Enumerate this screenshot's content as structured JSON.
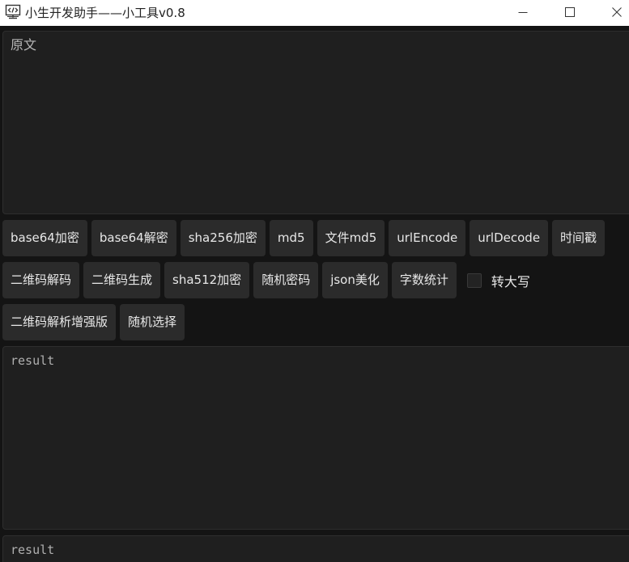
{
  "window": {
    "title": "小生开发助手——小工具v0.8",
    "icon": "code-monitor-icon",
    "controls": {
      "minimize": "minimize-icon",
      "maximize": "maximize-icon",
      "close": "close-icon"
    }
  },
  "source": {
    "placeholder": "原文"
  },
  "rows": [
    [
      "base64加密",
      "base64解密",
      "sha256加密",
      "md5",
      "文件md5",
      "urlEncode",
      "urlDecode",
      "时间戳"
    ],
    [
      "二维码解码",
      "二维码生成",
      "sha512加密",
      "随机密码",
      "json美化",
      "字数统计"
    ],
    [
      "二维码解析增强版",
      "随机选择"
    ]
  ],
  "uppercase_toggle": {
    "label": "转大写",
    "checked": false
  },
  "results": [
    {
      "placeholder": "result"
    },
    {
      "placeholder": "result"
    }
  ],
  "colors": {
    "background": "#141414",
    "panel": "#1f1f1f",
    "button": "#2b2b2b",
    "text": "#e8e8e8",
    "titlebar": "#ffffff"
  }
}
